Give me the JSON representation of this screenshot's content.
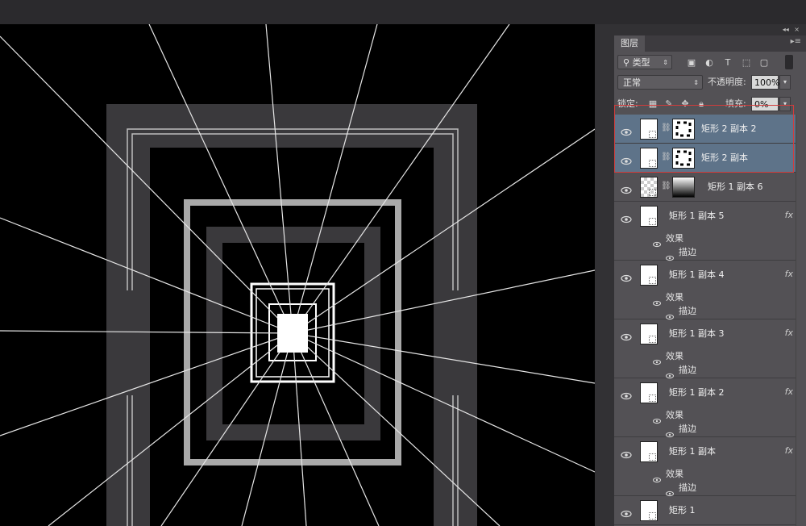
{
  "panel": {
    "collapse_glyph": "◂◂",
    "close_glyph": "×",
    "tab_label": "图层",
    "menu_icon": "panel-menu-icon"
  },
  "filter": {
    "kind_value": "类型",
    "icons": [
      "image-filter-icon",
      "adjustment-filter-icon",
      "type-filter-icon",
      "shape-filter-icon",
      "smart-object-filter-icon"
    ]
  },
  "blend": {
    "mode_value": "正常",
    "opacity_label": "不透明度:",
    "opacity_value": "100%"
  },
  "lock": {
    "label": "锁定:",
    "fill_label": "填充:",
    "fill_value": "0%"
  },
  "layers": [
    {
      "name": "矩形 2 副本 2",
      "selected": true,
      "type": "shape-mask"
    },
    {
      "name": "矩形 2 副本",
      "selected": true,
      "type": "shape-mask"
    },
    {
      "name": "矩形 1 副本 6",
      "selected": false,
      "type": "gradient-mask"
    },
    {
      "name": "矩形 1 副本 5",
      "selected": false,
      "type": "fx",
      "effects_label": "效果",
      "stroke_label": "描边",
      "fx": "fx"
    },
    {
      "name": "矩形 1 副本 4",
      "selected": false,
      "type": "fx",
      "effects_label": "效果",
      "stroke_label": "描边",
      "fx": "fx"
    },
    {
      "name": "矩形 1 副本 3",
      "selected": false,
      "type": "fx",
      "effects_label": "效果",
      "stroke_label": "描边",
      "fx": "fx"
    },
    {
      "name": "矩形 1 副本 2",
      "selected": false,
      "type": "fx",
      "effects_label": "效果",
      "stroke_label": "描边",
      "fx": "fx"
    },
    {
      "name": "矩形 1 副本",
      "selected": false,
      "type": "fx",
      "effects_label": "效果",
      "stroke_label": "描边",
      "fx": "fx"
    },
    {
      "name": "矩形 1",
      "selected": false,
      "type": "plain"
    }
  ],
  "colors": {
    "canvas": "#000000",
    "panel": "#535155",
    "selected_layer": "#5e7389",
    "highlight": "#d23c3c"
  }
}
